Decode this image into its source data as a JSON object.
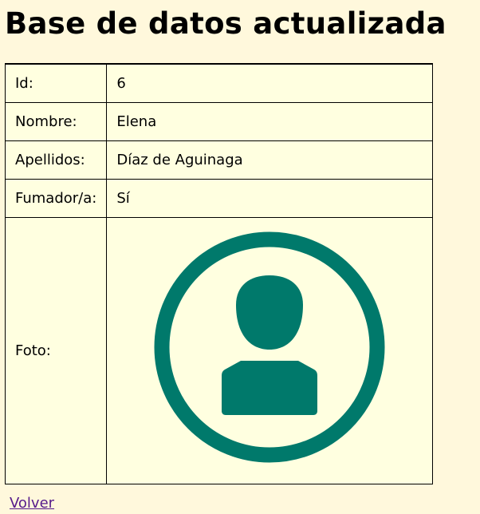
{
  "page": {
    "title": "Base de datos actualizada"
  },
  "record": {
    "rows": [
      {
        "label": "Id:",
        "value": "6"
      },
      {
        "label": "Nombre:",
        "value": "Elena"
      },
      {
        "label": "Apellidos:",
        "value": "Díaz de Aguinaga"
      },
      {
        "label": "Fumador/a:",
        "value": "Sí"
      }
    ],
    "photo_label": "Foto:",
    "photo_icon": "user-avatar-icon",
    "photo_color": "#00796b"
  },
  "links": {
    "back_label": "Volver"
  },
  "colors": {
    "page_background": "#fff8dc",
    "table_background": "#ffffe0",
    "link": "#551a8b"
  }
}
